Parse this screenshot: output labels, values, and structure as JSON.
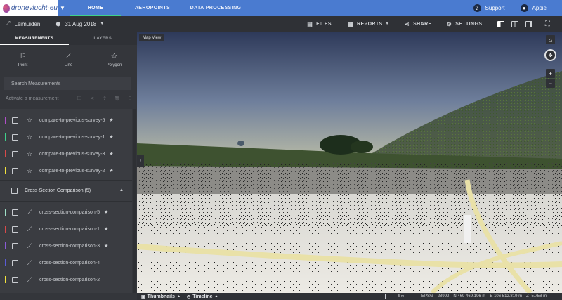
{
  "brand": {
    "name": "dronevlucht·eu"
  },
  "nav": {
    "tabs": [
      {
        "label": "HOME",
        "active": true
      },
      {
        "label": "AEROPOINTS",
        "active": false
      },
      {
        "label": "DATA PROCESSING",
        "active": false
      }
    ],
    "support_label": "Support",
    "user_label": "Appie"
  },
  "subbar": {
    "project": "Leimuiden",
    "date": "31 Aug 2018",
    "tools": {
      "files": "FILES",
      "reports": "REPORTS",
      "share": "SHARE",
      "settings": "SETTINGS"
    }
  },
  "panel": {
    "tabs": [
      {
        "label": "MEASUREMENTS",
        "active": true
      },
      {
        "label": "LAYERS",
        "active": false
      }
    ],
    "types": [
      {
        "label": "Point",
        "icon": "flag-icon"
      },
      {
        "label": "Line",
        "icon": "line-icon"
      },
      {
        "label": "Polygon",
        "icon": "polygon-icon"
      }
    ],
    "search_placeholder": "Search Measurements",
    "activate_label": "Activate a measurement",
    "compare_items": [
      {
        "label": "compare-to-previous-survey-5",
        "color": "#b04fc9"
      },
      {
        "label": "compare-to-previous-survey-1",
        "color": "#3fd18b"
      },
      {
        "label": "compare-to-previous-survey-3",
        "color": "#d94a4a"
      },
      {
        "label": "compare-to-previous-survey-2",
        "color": "#f2e23c"
      }
    ],
    "group": {
      "label": "Cross-Section Comparison (5)"
    },
    "cross_items": [
      {
        "label": "cross-section-comparison-5",
        "color": "#9fe0c8",
        "starred": true
      },
      {
        "label": "cross-section-comparison-1",
        "color": "#d94a4a",
        "starred": true
      },
      {
        "label": "cross-section-comparison-3",
        "color": "#8a5cd6",
        "starred": true
      },
      {
        "label": "cross-section-comparison-4",
        "color": "#5a5cd6",
        "starred": false
      },
      {
        "label": "cross-section-comparison-2",
        "color": "#f2e23c",
        "starred": false
      }
    ]
  },
  "map": {
    "tag": "Map View",
    "bottom": {
      "thumbnails": "Thumbnails",
      "timeline": "Timeline",
      "scale": "5 m",
      "epsg_label": "EPSG",
      "epsg": "28992",
      "n": "N  469 469.196 m",
      "e": "E  106 512.819 m",
      "z": "Z  -5.758 m"
    }
  }
}
